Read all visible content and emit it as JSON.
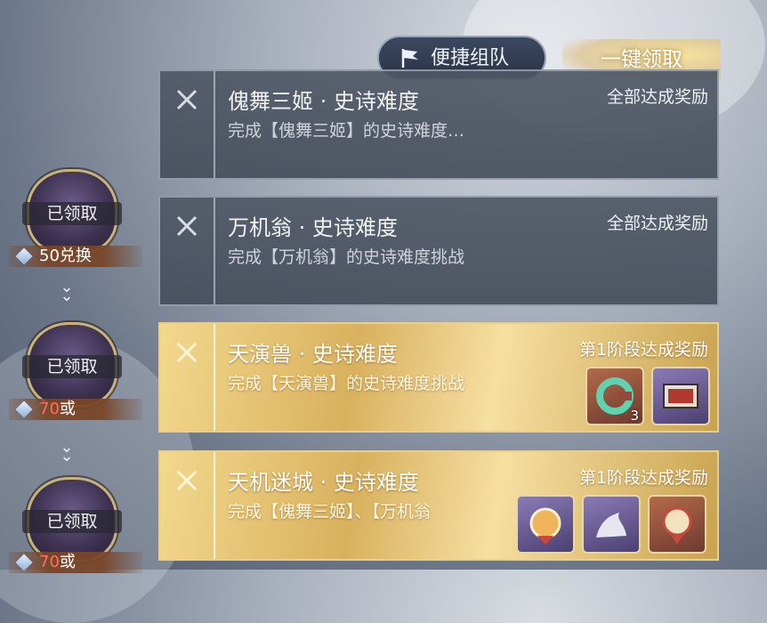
{
  "header": {
    "team_button_label": "便捷组队",
    "claim_all_label": "一键领取"
  },
  "milestones": [
    {
      "status": "已领取",
      "cost_amount": "50",
      "cost_suffix": "兑换"
    },
    {
      "status": "已领取",
      "cost_amount": "70",
      "cost_suffix": "或"
    },
    {
      "status": "已领取",
      "cost_amount": "70",
      "cost_suffix": "或"
    }
  ],
  "tasks": [
    {
      "title": "傀舞三姬 · 史诗难度",
      "description": "完成【傀舞三姬】的史诗难度…",
      "reward_label": "全部达成奖励",
      "state": "grey"
    },
    {
      "title": "万机翁 · 史诗难度",
      "description": "完成【万机翁】的史诗难度挑战",
      "reward_label": "全部达成奖励",
      "state": "grey"
    },
    {
      "title": "天演兽 · 史诗难度",
      "description": "完成【天演兽】的史诗难度挑战",
      "reward_label": "第1阶段达成奖励",
      "state": "gold",
      "rewards": [
        {
          "icon": "jade-ring-icon",
          "quantity": "3"
        },
        {
          "icon": "scroll-painting-icon",
          "quantity": ""
        }
      ]
    },
    {
      "title": "天机迷城 · 史诗难度",
      "description": "完成【傀舞三姬】、【万机翁",
      "reward_label": "第1阶段达成奖励",
      "state": "gold",
      "rewards": [
        {
          "icon": "badge-icon",
          "quantity": ""
        },
        {
          "icon": "beast-figure-icon",
          "quantity": ""
        },
        {
          "icon": "token-icon",
          "quantity": ""
        }
      ]
    }
  ],
  "colors": {
    "gold_card": "#d9b15e",
    "grey_card": "#505866",
    "cost_highlight": "#ff6f60"
  }
}
